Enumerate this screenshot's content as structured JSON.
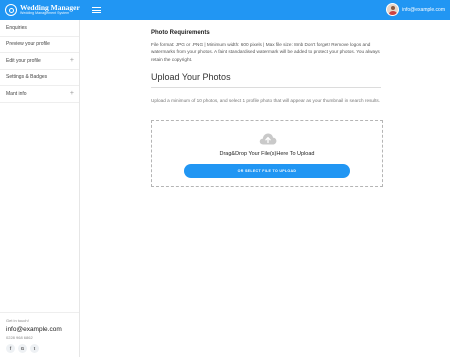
{
  "header": {
    "brand_title": "Wedding Manager",
    "brand_subtitle": "Wedding Management System",
    "user_email": "info@example.com"
  },
  "sidebar": {
    "items": [
      {
        "label": "Enquiries",
        "expandable": false
      },
      {
        "label": "Preview your profile",
        "expandable": false
      },
      {
        "label": "Edit your profile",
        "expandable": true
      },
      {
        "label": "Settings & Badges",
        "expandable": false
      },
      {
        "label": "Mant info",
        "expandable": true
      }
    ],
    "expand_symbol": "+",
    "footer": {
      "get_in_touch": "Get in touch!",
      "email": "info@example.com",
      "phone": "0228 968 6862",
      "socials": [
        {
          "icon": "facebook-icon",
          "glyph": "f"
        },
        {
          "icon": "google-icon",
          "glyph": "G"
        },
        {
          "icon": "twitter-icon",
          "glyph": "t"
        }
      ]
    }
  },
  "main": {
    "photo_requirements_title": "Photo Requirements",
    "photo_requirements_text": "File format: JPG or .PNG | Minimum width: 600 pixels | Max file size: 8mb Don't forget! Remove logos and watermarks from your photos. A faint standardised watermark will be added to protect your photos. You always retain the copyright.",
    "upload_title": "Upload Your Photos",
    "upload_text": "Upload a minimum of 10 photos, and select 1 profile photo that will appear as your thumbnail in search results.",
    "dropzone": {
      "label": "Drag&Drop Your File(s)Here To Upload",
      "button_label": "OR SELECT FILE TO UPLOAD",
      "icon": "cloud-upload-icon"
    }
  },
  "colors": {
    "primary": "#2196f3"
  }
}
